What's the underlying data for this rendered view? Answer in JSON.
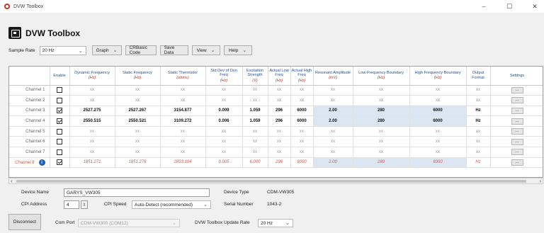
{
  "window": {
    "title": "DVW Toolbox",
    "controls": {
      "minimize": "–",
      "maximize": "☐",
      "close": "✕"
    }
  },
  "app": {
    "title": "DVW Toolbox"
  },
  "toolbar": {
    "sample_rate_label": "Sample Rate",
    "sample_rate_value": "20 Hz",
    "graph_label": "Graph",
    "crbasic_label": "CRBasic Code",
    "save_data_label": "Save Data",
    "view_label": "View",
    "help_label": "Help"
  },
  "grid": {
    "headers": [
      {
        "label": "Enable",
        "unit": ""
      },
      {
        "label": "Dynamic Frequency",
        "unit": "(Hz)"
      },
      {
        "label": "Static Frequency",
        "unit": "(Hz)"
      },
      {
        "label": "Static Thermistor",
        "unit": "(ohms)"
      },
      {
        "label": "Std Dev of Dyn Freq",
        "unit": "(Hz)"
      },
      {
        "label": "Excitation Strength",
        "unit": "(V)"
      },
      {
        "label": "Actual Low Freq",
        "unit": "(Hz)"
      },
      {
        "label": "Actual High Freq",
        "unit": "(Hz)"
      },
      {
        "label": "Resonant Amplitude",
        "unit": "(mV)"
      },
      {
        "label": "Low Frequency Boundary",
        "unit": "(Hz)"
      },
      {
        "label": "High Frequency Boundary",
        "unit": "(Hz)"
      },
      {
        "label": "Output Format",
        "unit": ""
      },
      {
        "label": "Settings",
        "unit": ""
      }
    ],
    "settings_button_label": "...",
    "rows": [
      {
        "name": "Channel 1",
        "state": "inactive",
        "enabled": false,
        "values": [
          "xx",
          "xx",
          "xx",
          "xx",
          "xx",
          "xx",
          "xx",
          "xx",
          "xx",
          "xx",
          "xx"
        ]
      },
      {
        "name": "Channel 2",
        "state": "inactive",
        "enabled": false,
        "values": [
          "xx",
          "xx",
          "xx",
          "xx",
          "xx",
          "xx",
          "xx",
          "xx",
          "xx",
          "xx",
          "xx"
        ]
      },
      {
        "name": "Channel 3",
        "state": "active",
        "enabled": true,
        "values": [
          "2527.275",
          "2527.267",
          "3154.877",
          "0.009",
          "1.059",
          "296",
          "6000",
          "2.00",
          "280",
          "6000",
          "Hz"
        ]
      },
      {
        "name": "Channel 4",
        "state": "active",
        "enabled": true,
        "values": [
          "2550.515",
          "2550.521",
          "3109.272",
          "0.006",
          "1.059",
          "296",
          "6000",
          "2.00",
          "280",
          "6000",
          "Hz"
        ]
      },
      {
        "name": "Channel 5",
        "state": "inactive",
        "enabled": false,
        "values": [
          "xx",
          "xx",
          "xx",
          "xx",
          "xx",
          "xx",
          "xx",
          "xx",
          "xx",
          "xx",
          "xx"
        ]
      },
      {
        "name": "Channel 6",
        "state": "inactive",
        "enabled": false,
        "values": [
          "xx",
          "xx",
          "xx",
          "xx",
          "xx",
          "xx",
          "xx",
          "xx",
          "xx",
          "xx",
          "xx"
        ]
      },
      {
        "name": "Channel 7",
        "state": "inactive",
        "enabled": false,
        "values": [
          "xx",
          "xx",
          "xx",
          "xx",
          "xx",
          "xx",
          "xx",
          "xx",
          "xx",
          "xx",
          "xx"
        ]
      },
      {
        "name": "Channel 8",
        "state": "warn",
        "enabled": true,
        "info": "i",
        "values": [
          "1851.271",
          "1851.276",
          "2833.104",
          "0.005",
          "6.000",
          "296",
          "6000",
          "2.00",
          "280",
          "6000",
          "Hz"
        ]
      }
    ]
  },
  "device": {
    "name_label": "Device Name",
    "name_value": "GARYS_VW305",
    "cpi_address_label": "CPI Address",
    "cpi_address_value": "4",
    "cpi_speed_label": "CPI Speed",
    "cpi_speed_value": "Auto-Detect (recommended)",
    "type_label": "Device Type",
    "type_value": "CDM-VW305",
    "serial_label": "Serial Number",
    "serial_value": "1043-2"
  },
  "connection": {
    "disconnect_label": "Disconnect",
    "com_port_label": "Com Port",
    "com_port_value": "CDM-VW300 (COM12)",
    "update_rate_label": "DVW Toolbox Update Rate",
    "update_rate_value": "20 Hz"
  },
  "colors": {
    "header_text": "#1f4e9c",
    "unit_text": "#c0392b",
    "warn_text": "#e0584a",
    "boundary_cell_bg": "#dce6f2",
    "info_icon": "#1f5fbf"
  }
}
